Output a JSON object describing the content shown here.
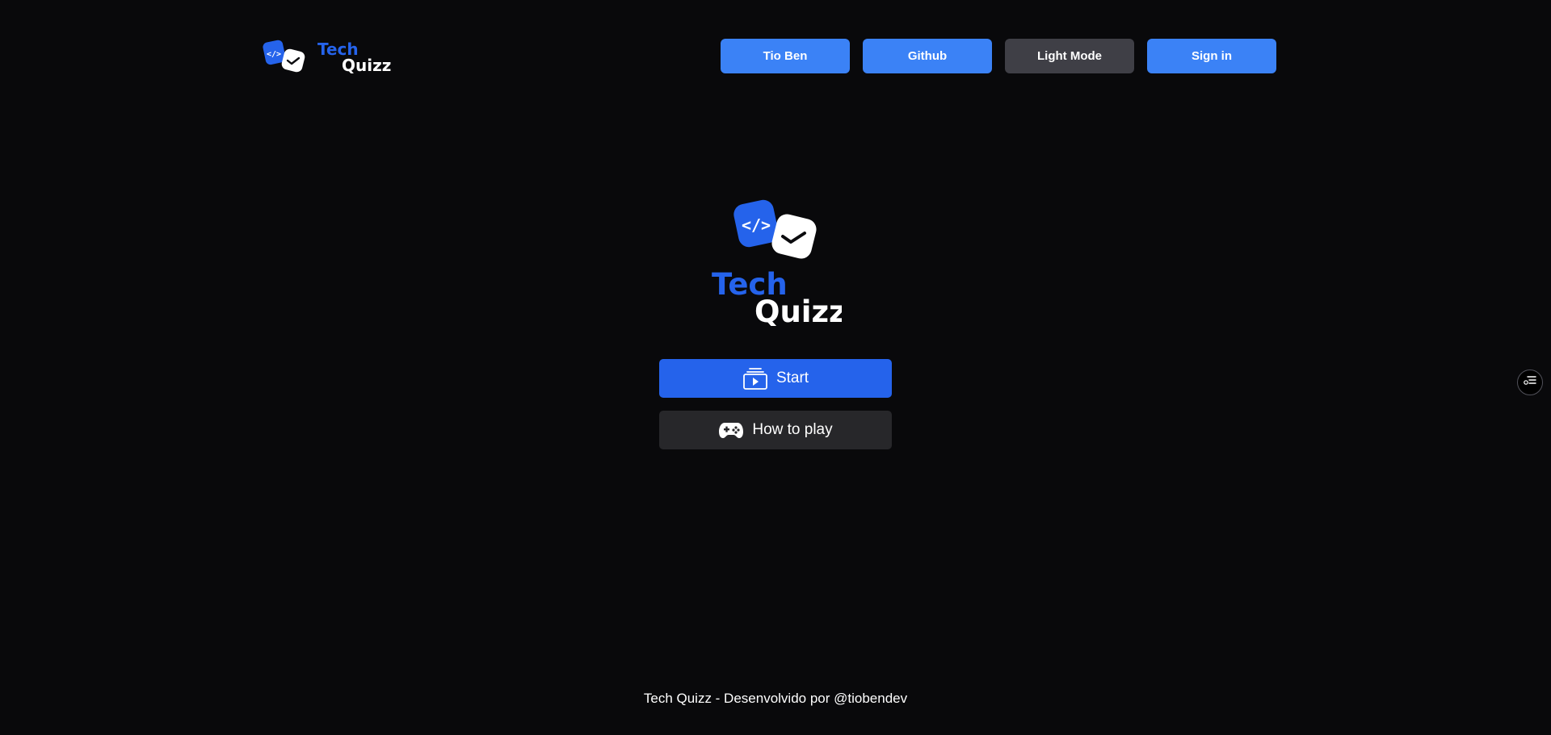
{
  "header": {
    "logo": {
      "word1": "Tech",
      "word2": "Quizz"
    },
    "nav": [
      {
        "label": "Tio Ben"
      },
      {
        "label": "Github"
      },
      {
        "label": "Light Mode"
      },
      {
        "label": "Sign in"
      }
    ]
  },
  "hero": {
    "logo": {
      "word1": "Tech",
      "word2": "Quizz"
    },
    "start_label": "Start",
    "howto_label": "How to play"
  },
  "icons": {
    "start": "play-stack-icon",
    "howto": "gamepad-icon",
    "floating": "filter-list-icon"
  },
  "footer": {
    "text": "Tech Quizz - Desenvolvido por @tiobendev"
  },
  "colors": {
    "background": "#09090b",
    "primary": "#3b82f6",
    "start": "#2563eb",
    "secondary": "#27272a",
    "light_mode_button": "#3f3f46",
    "brand_blue": "#2563eb"
  }
}
